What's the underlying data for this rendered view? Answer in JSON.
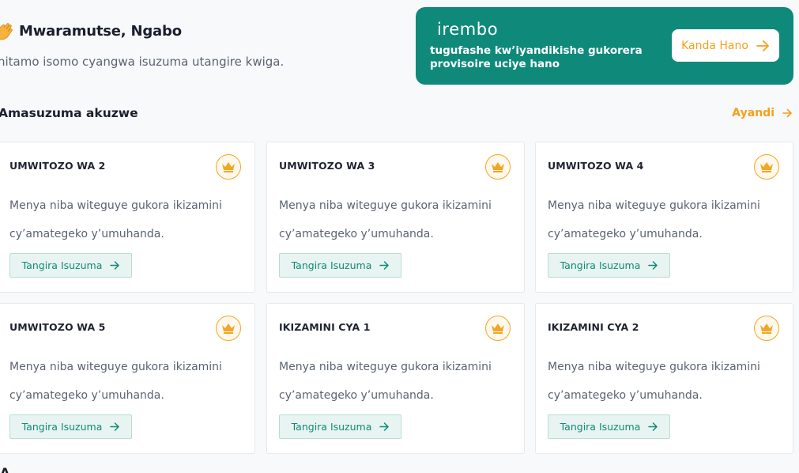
{
  "greeting": {
    "wave_icon": "waving-hand-icon",
    "text": "Mwaramutse, Ngabo"
  },
  "subtitle": "hitamo isomo cyangwa isuzuma utangire kwiga.",
  "banner": {
    "logo": "irembo",
    "text": "tugufashe kw’iyandikishe gukorera provisoire uciye hano",
    "button_label": "Kanda Hano",
    "background_color": "#0f8a7a",
    "button_text_color": "#f59f1c"
  },
  "section": {
    "title": "Amasuzuma akuzwe",
    "see_all_label": "Ayandi",
    "accent_color": "#f59f1c"
  },
  "cards": [
    {
      "title": "UMWITOZO WA 2",
      "description": "Menya niba witeguye gukora ikizamini cy’amategeko y’umuhanda.",
      "button_label": "Tangira Isuzuma",
      "badge_icon": "crown-icon"
    },
    {
      "title": "UMWITOZO WA 3",
      "description": "Menya niba witeguye gukora ikizamini cy’amategeko y’umuhanda.",
      "button_label": "Tangira Isuzuma",
      "badge_icon": "crown-icon"
    },
    {
      "title": "UMWITOZO WA 4",
      "description": "Menya niba witeguye gukora ikizamini cy’amategeko y’umuhanda.",
      "button_label": "Tangira Isuzuma",
      "badge_icon": "crown-icon"
    },
    {
      "title": "UMWITOZO WA 5",
      "description": "Menya niba witeguye gukora ikizamini cy’amategeko y’umuhanda.",
      "button_label": "Tangira Isuzuma",
      "badge_icon": "crown-icon"
    },
    {
      "title": "IKIZAMINI CYA 1",
      "description": "Menya niba witeguye gukora ikizamini cy’amategeko y’umuhanda.",
      "button_label": "Tangira Isuzuma",
      "badge_icon": "crown-icon"
    },
    {
      "title": "IKIZAMINI CYA 2",
      "description": "Menya niba witeguye gukora ikizamini cy’amategeko y’umuhanda.",
      "button_label": "Tangira Isuzuma",
      "badge_icon": "crown-icon"
    }
  ],
  "next_section_partial": "A"
}
